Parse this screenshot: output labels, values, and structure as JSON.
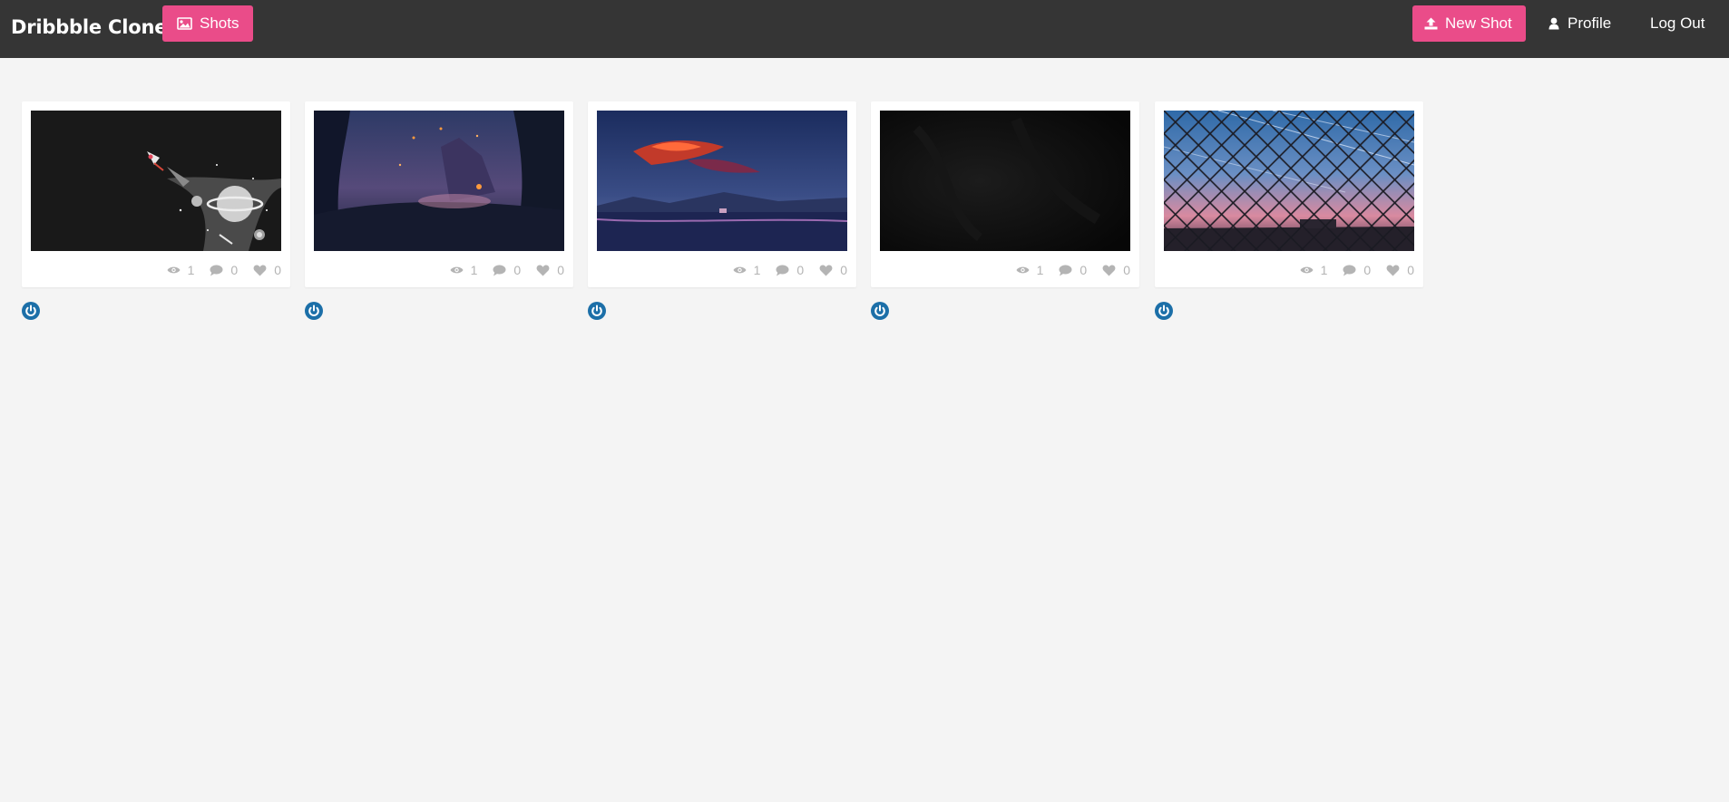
{
  "navbar": {
    "brand": "Dribbble Clone",
    "shots_label": "Shots",
    "new_shot_label": "New Shot",
    "profile_label": "Profile",
    "logout_label": "Log Out"
  },
  "colors": {
    "navbar_bg": "#353535",
    "accent_pink": "#ea4c89",
    "page_bg": "#f4f4f4",
    "avatar_blue": "#1c6fa8",
    "stat_gray": "#b4b4b4"
  },
  "icons": {
    "shots": "image-icon",
    "new_shot": "upload-icon",
    "profile": "user-icon",
    "views": "eye-icon",
    "comments": "comment-icon",
    "likes": "heart-icon",
    "avatar": "power-icon"
  },
  "shots": [
    {
      "views": "1",
      "comments": "0",
      "likes": "0"
    },
    {
      "views": "1",
      "comments": "0",
      "likes": "0"
    },
    {
      "views": "1",
      "comments": "0",
      "likes": "0"
    },
    {
      "views": "1",
      "comments": "0",
      "likes": "0"
    },
    {
      "views": "1",
      "comments": "0",
      "likes": "0"
    }
  ]
}
